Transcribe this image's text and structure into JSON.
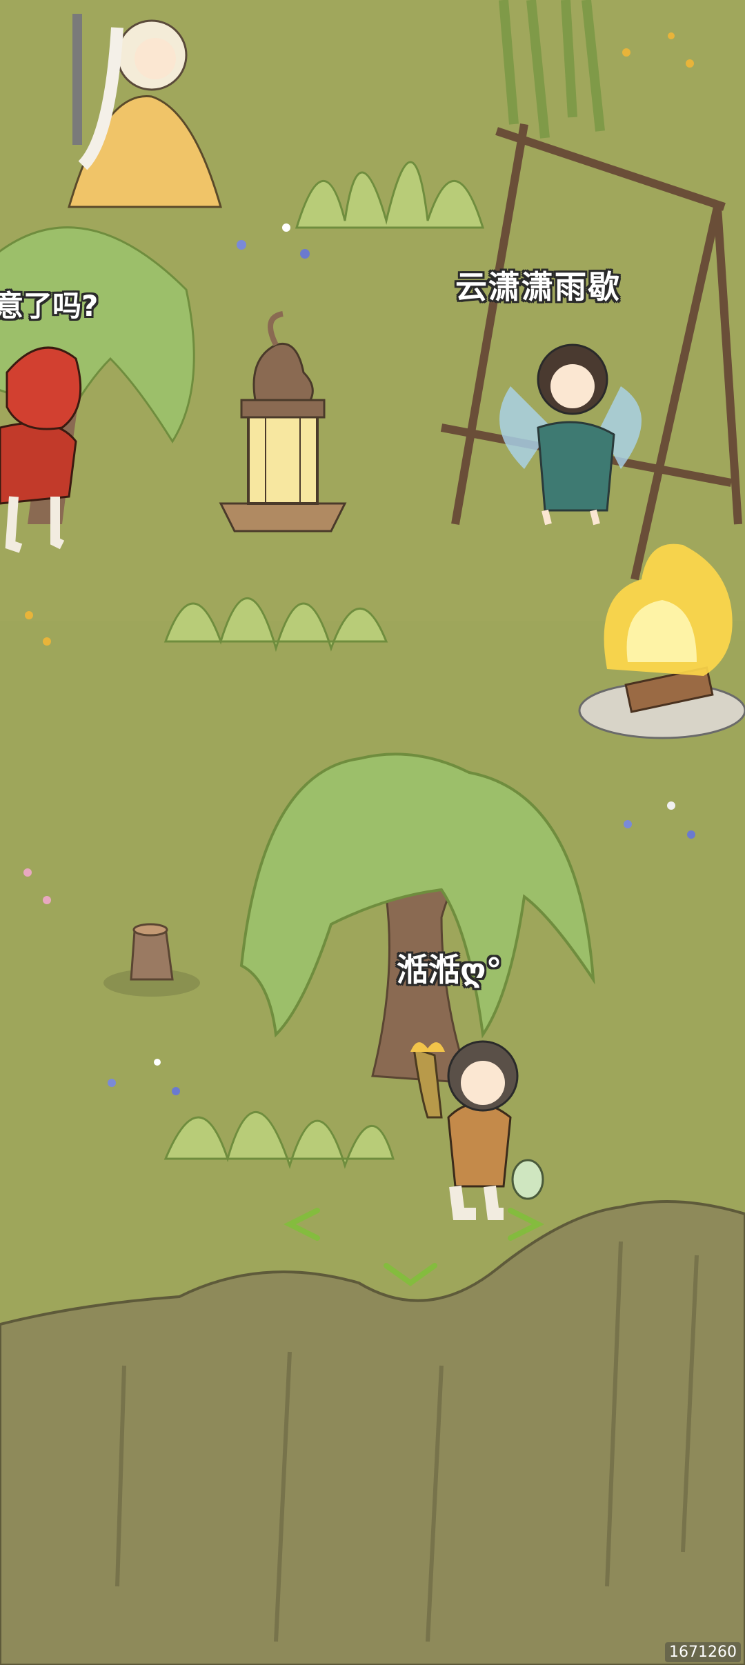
{
  "scene": {
    "characters": [
      {
        "id": "player",
        "nameplate": "湉湉ღ°"
      },
      {
        "id": "fairy-npc",
        "nameplate": "云潇潇雨歇"
      }
    ],
    "chat_bubble_text": "意了吗?",
    "watermark": "1671260"
  },
  "colors": {
    "grass": "#9ea65b",
    "cliff": "#8e8a5a",
    "willow": "#9cbf6a",
    "trunk": "#8a6a52",
    "fire": "#ffd84a"
  },
  "icons": [
    "lantern-icon",
    "campfire-icon",
    "swing-icon",
    "tree-stump-icon",
    "move-arrow-icon"
  ]
}
